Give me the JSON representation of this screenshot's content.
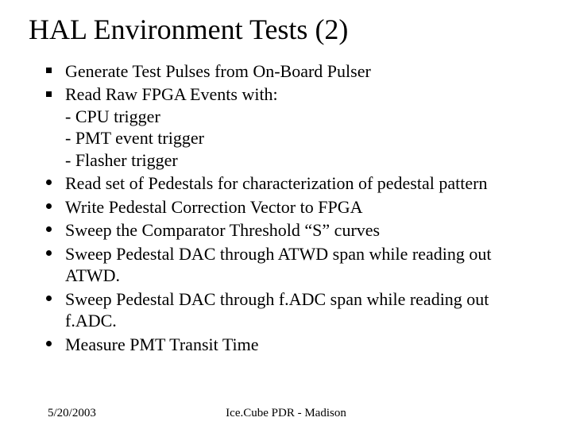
{
  "title": "HAL Environment Tests (2)",
  "bullets": {
    "b0": {
      "text": "Generate Test Pulses from On-Board Pulser"
    },
    "b1": {
      "text": "Read Raw FPGA Events with:",
      "sub1": "- CPU trigger",
      "sub2": "- PMT event trigger",
      "sub3": "- Flasher trigger"
    },
    "b2": {
      "text": "Read set of Pedestals for characterization of pedestal pattern"
    },
    "b3": {
      "text": "Write Pedestal Correction Vector to FPGA"
    },
    "b4": {
      "text": "Sweep  the Comparator Threshold “S” curves"
    },
    "b5": {
      "text": "Sweep Pedestal DAC through ATWD span while reading out ATWD."
    },
    "b6": {
      "text": "Sweep Pedestal DAC through f.ADC span while reading out f.ADC."
    },
    "b7": {
      "text": "Measure PMT Transit Time"
    }
  },
  "footer": {
    "date": "5/20/2003",
    "center": "Ice.Cube PDR - Madison"
  }
}
